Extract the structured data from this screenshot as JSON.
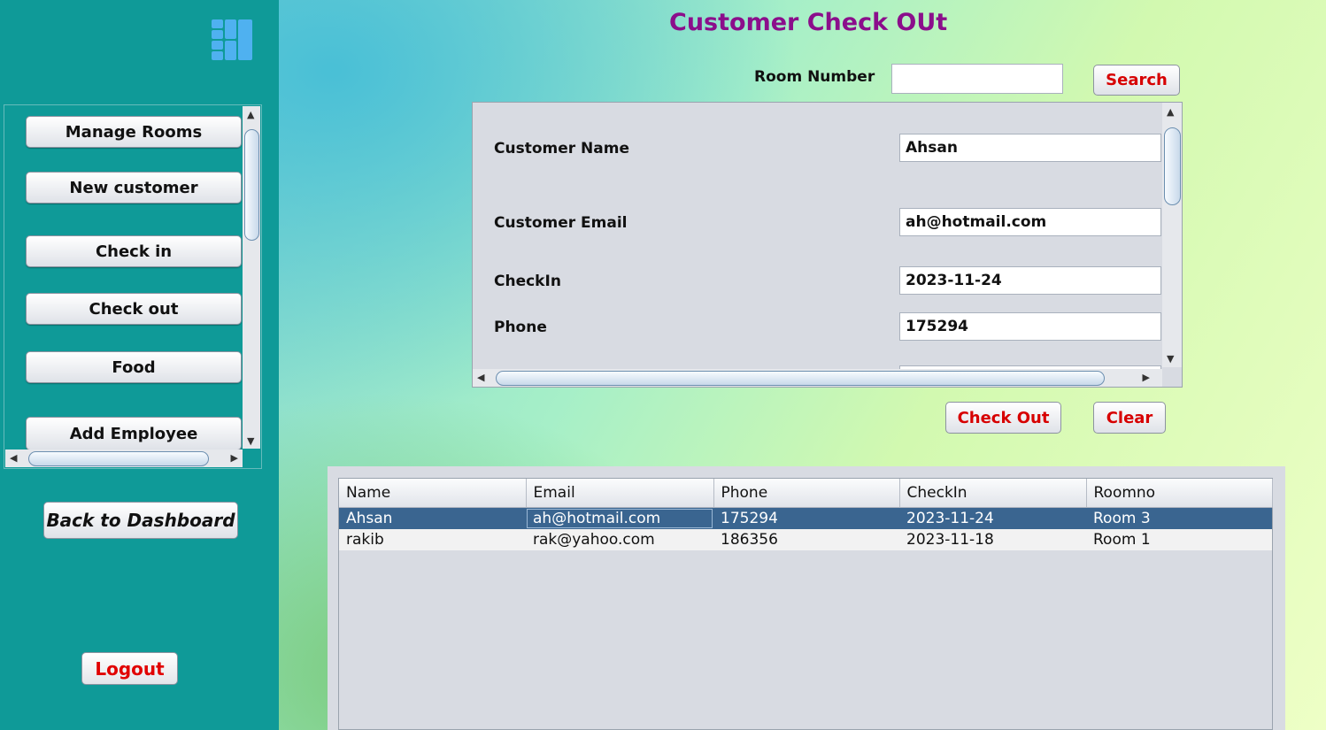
{
  "window": {
    "title": "Customer Check OUt"
  },
  "sidebar": {
    "logo_icon": "grid-logo-icon",
    "items": [
      {
        "label": "Manage Rooms"
      },
      {
        "label": "New customer"
      },
      {
        "label": "Check in"
      },
      {
        "label": "Check out"
      },
      {
        "label": "Food"
      },
      {
        "label": "Add Employee"
      }
    ],
    "back_label": "Back to Dashboard",
    "logout_label": "Logout"
  },
  "search": {
    "label": "Room Number",
    "value": "",
    "button_label": "Search"
  },
  "form": {
    "fields": [
      {
        "label": "Customer Name",
        "value": "Ahsan"
      },
      {
        "label": "Customer Email",
        "value": "ah@hotmail.com"
      },
      {
        "label": "CheckIn",
        "value": "2023-11-24"
      },
      {
        "label": "Phone",
        "value": "175294"
      }
    ]
  },
  "actions": {
    "checkout_label": "Check Out",
    "clear_label": "Clear"
  },
  "table": {
    "columns": [
      "Name",
      "Email",
      "Phone",
      "CheckIn",
      "Roomno"
    ],
    "rows": [
      {
        "name": "Ahsan",
        "email": "ah@hotmail.com",
        "phone": "175294",
        "checkin": "2023-11-24",
        "roomno": "Room 3"
      },
      {
        "name": "rakib",
        "email": "rak@yahoo.com",
        "phone": "186356",
        "checkin": "2023-11-18",
        "roomno": "Room 1"
      }
    ]
  },
  "colors": {
    "sidebar_bg": "#0f9a98",
    "title": "#8b0e8b",
    "accent_red": "#d70000",
    "selected_row": "#3a6590"
  }
}
